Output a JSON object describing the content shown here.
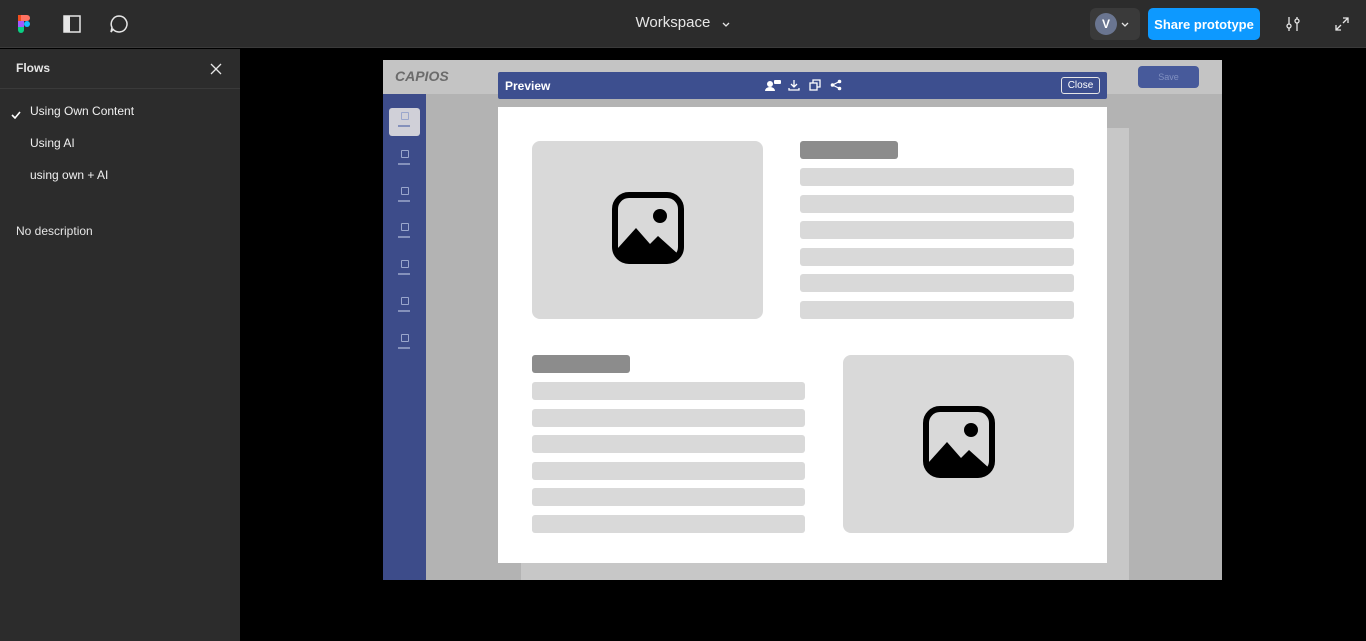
{
  "topbar": {
    "title": "Workspace",
    "avatar_initial": "V",
    "share_label": "Share prototype",
    "icons": [
      "figma-logo-icon",
      "sidebar-toggle-icon",
      "comment-icon",
      "chevron-down-icon",
      "settings-sliders-icon",
      "expand-icon"
    ]
  },
  "sidebar": {
    "title": "Flows",
    "flows": [
      {
        "label": "Using Own Content",
        "selected": true
      },
      {
        "label": "Using AI",
        "selected": false
      },
      {
        "label": "using own + AI",
        "selected": false
      }
    ],
    "description": "No description"
  },
  "frame": {
    "logo_text": "CAPIOS",
    "button_label": "Save"
  },
  "preview": {
    "title": "Preview",
    "close_label": "Close",
    "icons": [
      "users-icon",
      "download-icon",
      "duplicate-icon",
      "share-icon"
    ]
  },
  "colors": {
    "accent": "#0d99ff",
    "preview_header": "#3d4f8f",
    "frame_sidebar": "#3d4c8a"
  }
}
